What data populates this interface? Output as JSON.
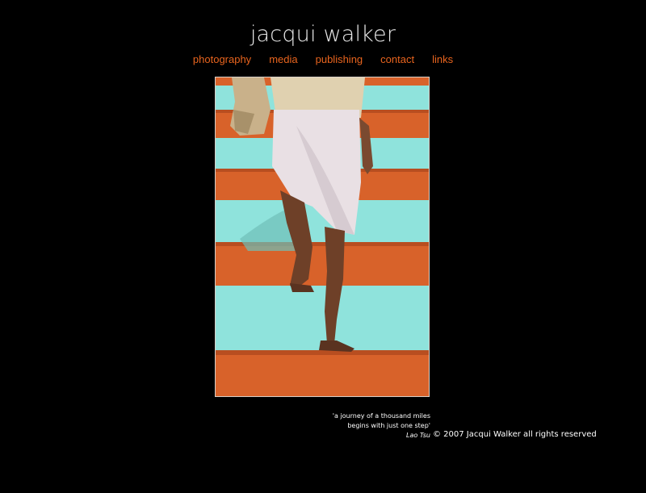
{
  "header": {
    "title": "jacqui walker"
  },
  "nav": {
    "items": [
      {
        "label": "photography"
      },
      {
        "label": "media"
      },
      {
        "label": "publishing"
      },
      {
        "label": "contact"
      },
      {
        "label": "links"
      }
    ]
  },
  "photo": {
    "subject": "person in white dhoti climbing orange and turquoise striped steps"
  },
  "quote": {
    "line1": "'a journey of a thousand miles",
    "line2": "begins with just one step'",
    "author": "Lao Tsu"
  },
  "footer": {
    "copyright": "© 2007 Jacqui Walker all rights reserved"
  },
  "colors": {
    "background": "#000000",
    "nav_link": "#e8641e",
    "stair_orange": "#d8622a",
    "stair_turquoise": "#8fe3dc"
  }
}
